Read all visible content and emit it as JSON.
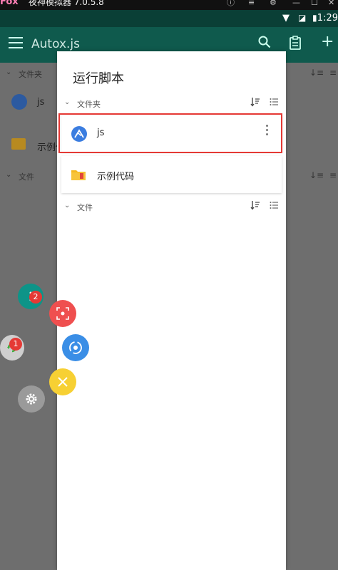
{
  "emulator": {
    "logo": "Fox",
    "title": "夜神模拟器 7.0.5.8"
  },
  "status_bar": {
    "time": "1:29"
  },
  "toolbar": {
    "title": "Autox.js"
  },
  "background": {
    "section_folders": "文件夹",
    "item_js": "js",
    "item_examples": "示例代",
    "section_files": "文件"
  },
  "dialog": {
    "title": "运行脚本",
    "section_folders": "文件夹",
    "items": [
      {
        "name": "js",
        "icon": "autojs-icon"
      },
      {
        "name": "示例代码",
        "icon": "folder-icon"
      }
    ],
    "section_files": "文件"
  },
  "floating": {
    "menu_badge": "2",
    "script_badge": "1"
  },
  "colors": {
    "toolbar": "#0f5a4d",
    "status": "#0a3f36",
    "highlight": "#e53935",
    "fab_teal": "#0d9488",
    "fab_red": "#ef4f4f",
    "fab_blue": "#3a8ee6",
    "fab_yellow": "#f7d033",
    "fab_gray": "#9a9a9a"
  }
}
